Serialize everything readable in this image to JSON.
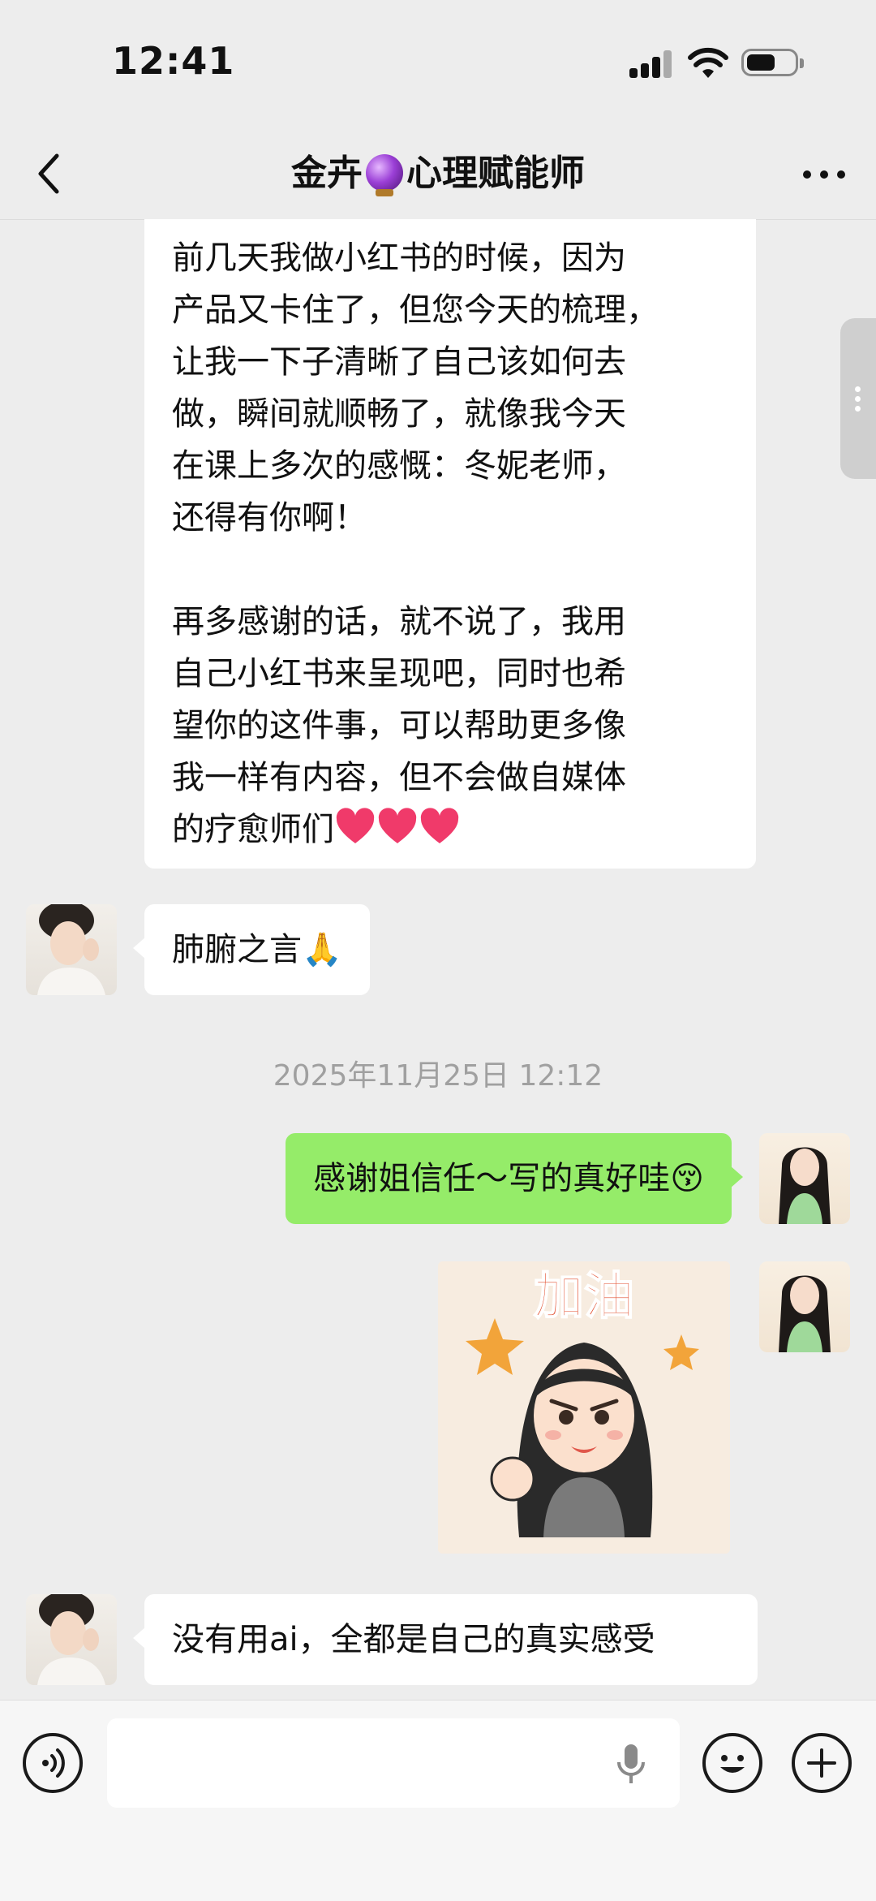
{
  "status_bar": {
    "time": "12:41"
  },
  "header": {
    "title_prefix": "金卉",
    "title_suffix": "心理赋能师",
    "title_icon": "crystal-ball-icon"
  },
  "messages": [
    {
      "sender": "contact",
      "paragraph1": "前几天我做小红书的时候，因为\n产品又卡住了，但您今天的梳理，\n让我一下子清晰了自己该如何去\n做，瞬间就顺畅了，就像我今天\n在课上多次的感慨：冬妮老师，\n还得有你啊！",
      "paragraph2": "再多感谢的话，就不说了，我用\n自己小红书来呈现吧，同时也希\n望你的这件事，可以帮助更多像\n我一样有内容，但不会做自媒体\n的疗愈师们",
      "emoji": "heart-icon x3"
    },
    {
      "sender": "contact",
      "text": "肺腑之言🙏"
    },
    {
      "sender": "me",
      "text": "感谢姐信任～写的真好哇😚"
    },
    {
      "sender": "me",
      "type": "sticker",
      "sticker_text": "加油"
    },
    {
      "sender": "contact",
      "text": "没有用ai，全都是自己的真实感受"
    }
  ],
  "timestamp": "2025年11月25日 12:12",
  "colors": {
    "background": "#ededed",
    "my_bubble": "#95ec69",
    "their_bubble": "#ffffff",
    "timestamp": "#a0a0a0"
  }
}
